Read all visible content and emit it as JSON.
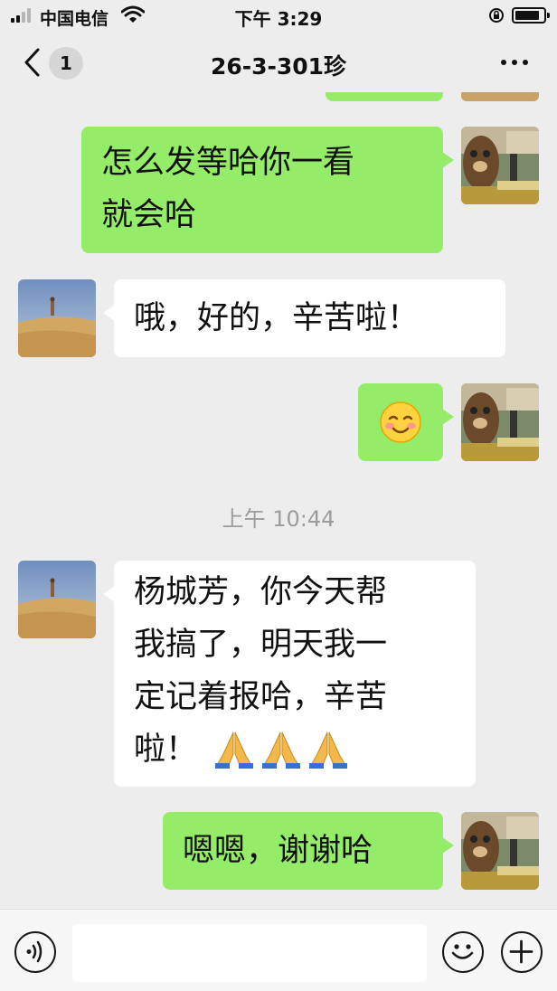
{
  "status_bar": {
    "carrier": "中国电信",
    "time": "下午 3:29"
  },
  "nav": {
    "unread_count": "1",
    "title": "26-3-301珍"
  },
  "messages": [
    {
      "direction": "out",
      "text_lines": [
        "怎么发等哈你一看",
        "就会哈"
      ]
    },
    {
      "direction": "in",
      "text_lines": [
        "哦，好的，辛苦啦！"
      ]
    },
    {
      "direction": "out",
      "emoji": "smiling-face"
    },
    {
      "direction": "in",
      "text_lines": [
        "杨城芳，你今天帮",
        "我搞了，明天我一",
        "定记着报哈，辛苦",
        "啦！"
      ],
      "emoji_suffix": [
        "folded-hands",
        "folded-hands",
        "folded-hands"
      ]
    },
    {
      "direction": "out",
      "text_lines": [
        "嗯嗯，谢谢哈"
      ]
    }
  ],
  "time_divider": "上午 10:44",
  "colors": {
    "outgoing_bubble": "#95ec69",
    "incoming_bubble": "#ffffff",
    "chat_background": "#ededed"
  },
  "icons": {
    "back": "chevron-left-icon",
    "more": "more-dots-icon",
    "voice": "voice-icon",
    "emoji": "emoji-icon",
    "add": "plus-icon"
  }
}
